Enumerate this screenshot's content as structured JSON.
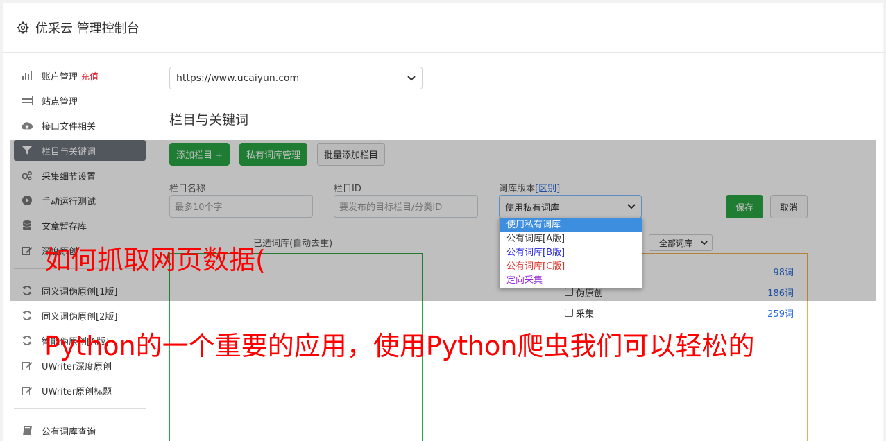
{
  "header": {
    "title": "优采云 管理控制台"
  },
  "sidebar": {
    "items": [
      {
        "label": "账户管理",
        "extra": "充值",
        "icon": "bar-chart-icon"
      },
      {
        "label": "站点管理",
        "icon": "server-icon"
      },
      {
        "label": "接口文件相关",
        "icon": "cloud-upload-icon"
      },
      {
        "label": "栏目与关键词",
        "icon": "filter-icon",
        "active": true
      },
      {
        "label": "采集细节设置",
        "icon": "cogs-icon"
      },
      {
        "label": "手动运行测试",
        "icon": "play-icon"
      },
      {
        "label": "文章暂存库",
        "icon": "database-icon"
      },
      {
        "label": "深度原创",
        "icon": "edit-icon"
      }
    ],
    "items2": [
      {
        "label": "同义词伪原创[1版]",
        "icon": "refresh-icon"
      },
      {
        "label": "同义词伪原创[2版]",
        "icon": "refresh-icon"
      },
      {
        "label": "智能伪原创[A版]",
        "icon": "refresh-icon"
      },
      {
        "label": "UWriter深度原创",
        "icon": "edit-icon"
      },
      {
        "label": "UWriter原创标题",
        "icon": "edit-icon"
      }
    ],
    "items3": [
      {
        "label": "公有词库查询",
        "icon": "book-icon"
      }
    ]
  },
  "main": {
    "site_select": "https://www.ucaiyun.com",
    "section_title": "栏目与关键词",
    "buttons": {
      "add_column": "添加栏目 +",
      "private_lib": "私有词库管理",
      "batch_add": "批量添加栏目"
    },
    "form": {
      "name_label": "栏目名称",
      "name_placeholder": "最多10个字",
      "id_label": "栏目ID",
      "id_placeholder": "要发布的目标栏目/分类ID",
      "version_label": "词库版本",
      "version_link": "[区别]",
      "version_selected": "使用私有词库",
      "save": "保存",
      "cancel": "取消"
    },
    "dropdown": [
      {
        "label": "使用私有词库",
        "color": "#ffffff",
        "selected": true
      },
      {
        "label": "公有词库[A版]",
        "color": "#333333"
      },
      {
        "label": "公有词库[B版]",
        "color": "#2a2ad9"
      },
      {
        "label": "公有词库[C版]",
        "color": "#d9342a"
      },
      {
        "label": "定向采集",
        "color": "#9b2ad9"
      }
    ],
    "left_panel_title": "已选词库(自动去重)",
    "lib_select": "全部词库",
    "lib_rows": [
      {
        "label": "",
        "count": "98词"
      },
      {
        "label": "伪原创",
        "count": "186词"
      },
      {
        "label": "采集",
        "count": "259词"
      }
    ]
  },
  "ads": {
    "line1": "如何抓取网页数据(",
    "line2": "Python的一个重要的应用，使用Python爬虫我们可以轻松的"
  },
  "colors": {
    "primary_green": "#28a745",
    "active_nav": "#6c757d",
    "recharge": "#e0202a",
    "link": "#2a6bd9",
    "ad_text": "#ff0000"
  }
}
